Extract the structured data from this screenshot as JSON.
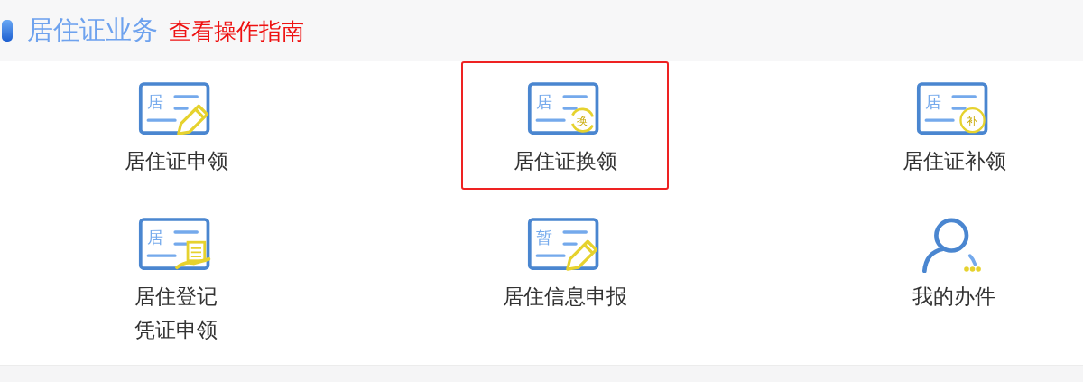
{
  "header": {
    "title": "居住证业务",
    "guide_link": "查看操作指南"
  },
  "services": [
    {
      "label_lines": [
        "居住证申领"
      ],
      "icon": {
        "kind": "pencil",
        "card_char": "居"
      },
      "highlighted": false
    },
    {
      "label_lines": [
        "居住证换领"
      ],
      "icon": {
        "kind": "swap",
        "card_char": "居",
        "badge_char": "换"
      },
      "highlighted": true
    },
    {
      "label_lines": [
        "居住证补领"
      ],
      "icon": {
        "kind": "badge",
        "card_char": "居",
        "badge_char": "补"
      },
      "highlighted": false
    },
    {
      "label_lines": [
        "居住登记",
        "凭证申领"
      ],
      "icon": {
        "kind": "receipt",
        "card_char": "居"
      },
      "highlighted": false
    },
    {
      "label_lines": [
        "居住信息申报"
      ],
      "icon": {
        "kind": "pencil",
        "card_char": "暂"
      },
      "highlighted": false
    },
    {
      "label_lines": [
        "我的办件"
      ],
      "icon": {
        "kind": "person"
      },
      "highlighted": false
    }
  ]
}
